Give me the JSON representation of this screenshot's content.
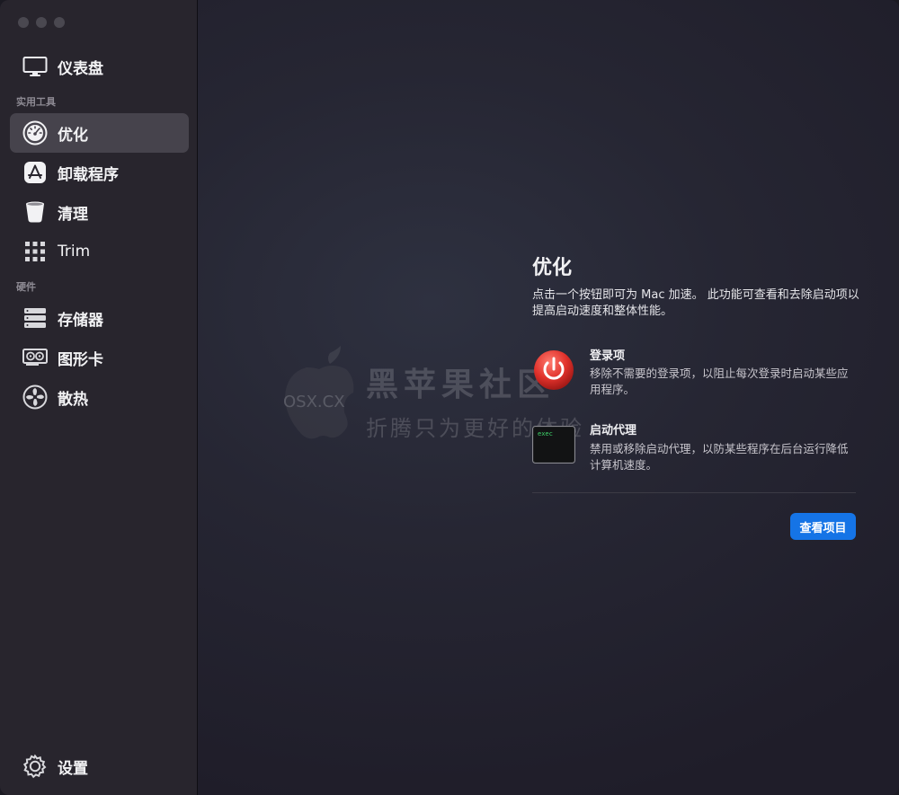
{
  "sidebar": {
    "top_item": {
      "label": "仪表盘",
      "icon": "monitor-icon"
    },
    "section_tools": "实用工具",
    "tools": [
      {
        "label": "优化",
        "icon": "speedometer-icon",
        "active": true
      },
      {
        "label": "卸载程序",
        "icon": "app-store-icon",
        "active": false
      },
      {
        "label": "清理",
        "icon": "trash-can-icon",
        "active": false
      },
      {
        "label": "Trim",
        "icon": "grid-icon",
        "active": false
      }
    ],
    "section_hardware": "硬件",
    "hardware": [
      {
        "label": "存储器",
        "icon": "storage-icon"
      },
      {
        "label": "图形卡",
        "icon": "graphics-card-icon"
      },
      {
        "label": "散热",
        "icon": "fan-icon"
      }
    ],
    "settings": {
      "label": "设置",
      "icon": "gear-icon"
    }
  },
  "main": {
    "title": "优化",
    "description": "点击一个按钮即可为 Mac 加速。 此功能可查看和去除启动项以提高启动速度和整体性能。",
    "features": [
      {
        "title": "登录项",
        "description": "移除不需要的登录项，以阻止每次登录时启动某些应用程序。",
        "icon": "power-icon"
      },
      {
        "title": "启动代理",
        "description": "禁用或移除启动代理，以防某些程序在后台运行降低计算机速度。",
        "icon": "terminal-icon",
        "icon_text": "exec"
      }
    ],
    "button_label": "查看项目"
  },
  "watermark": {
    "big": "黑苹果社区",
    "small": "折腾只为更好的体验",
    "logo_text": "OSX.CX"
  },
  "colors": {
    "accent": "#1574e6",
    "sidebar_bg": "#28252d",
    "active_bg": "#46434c",
    "power_red": "#e0312b"
  }
}
